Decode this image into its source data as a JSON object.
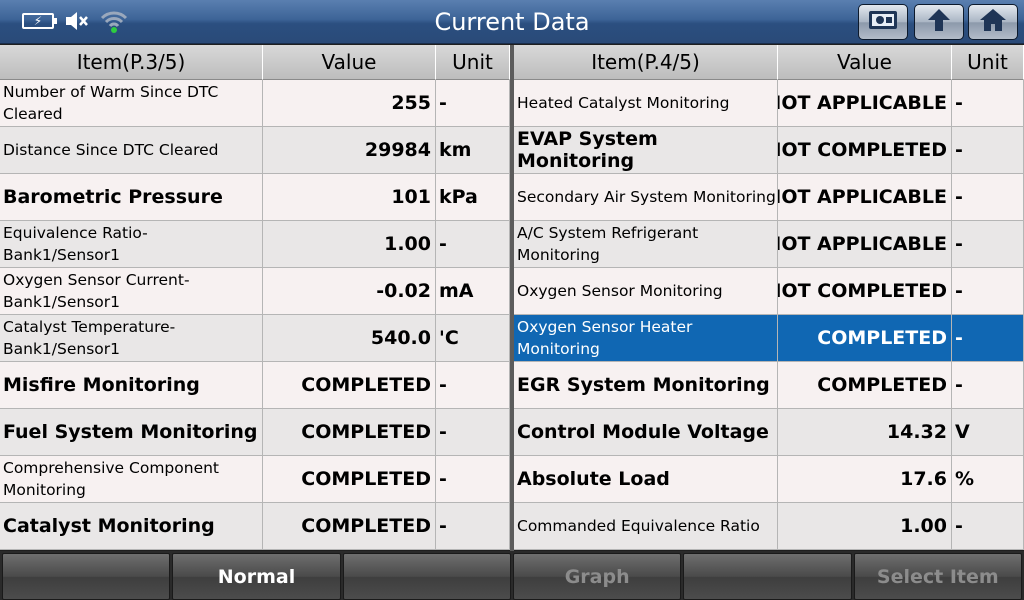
{
  "header": {
    "title": "Current Data",
    "status_icons": [
      "battery-charging-icon",
      "speaker-muted-icon",
      "wifi-icon"
    ],
    "buttons": [
      "screenshot-icon",
      "back-arrow-icon",
      "home-icon"
    ]
  },
  "left_table": {
    "columns": {
      "item": "Item(P.3/5)",
      "value": "Value",
      "unit": "Unit"
    },
    "rows": [
      {
        "item": "Number of Warm Since DTC Cleared",
        "value": "255",
        "unit": "-"
      },
      {
        "item": "Distance Since DTC Cleared",
        "value": "29984",
        "unit": "km"
      },
      {
        "item": "Barometric Pressure",
        "value": "101",
        "unit": "kPa"
      },
      {
        "item": "Equivalence Ratio-Bank1/Sensor1",
        "value": "1.00",
        "unit": "-"
      },
      {
        "item": "Oxygen Sensor Current-Bank1/Sensor1",
        "value": "-0.02",
        "unit": "mA"
      },
      {
        "item": "Catalyst Temperature-Bank1/Sensor1",
        "value": "540.0",
        "unit": "'C"
      },
      {
        "item": "Misfire Monitoring",
        "value": "COMPLETED",
        "unit": "-"
      },
      {
        "item": "Fuel System Monitoring",
        "value": "COMPLETED",
        "unit": "-"
      },
      {
        "item": "Comprehensive Component Monitoring",
        "value": "COMPLETED",
        "unit": "-"
      },
      {
        "item": "Catalyst Monitoring",
        "value": "COMPLETED",
        "unit": "-"
      }
    ]
  },
  "right_table": {
    "columns": {
      "item": "Item(P.4/5)",
      "value": "Value",
      "unit": "Unit"
    },
    "rows": [
      {
        "item": "Heated Catalyst Monitoring",
        "value": "NOT APPLICABLE",
        "unit": "-"
      },
      {
        "item": "EVAP System Monitoring",
        "value": "NOT COMPLETED",
        "unit": "-"
      },
      {
        "item": "Secondary Air System Monitoring",
        "value": "NOT APPLICABLE",
        "unit": "-"
      },
      {
        "item": "A/C System Refrigerant Monitoring",
        "value": "NOT APPLICABLE",
        "unit": "-"
      },
      {
        "item": "Oxygen Sensor Monitoring",
        "value": "NOT COMPLETED",
        "unit": "-"
      },
      {
        "item": "Oxygen Sensor Heater Monitoring",
        "value": "COMPLETED",
        "unit": "-"
      },
      {
        "item": "EGR System Monitoring",
        "value": "COMPLETED",
        "unit": "-"
      },
      {
        "item": "Control Module Voltage",
        "value": "14.32",
        "unit": "V"
      },
      {
        "item": "Absolute Load",
        "value": "17.6",
        "unit": "%"
      },
      {
        "item": "Commanded Equivalence Ratio",
        "value": "1.00",
        "unit": "-"
      }
    ]
  },
  "bottom_bar": {
    "normal_label": "Normal",
    "graph_label": "Graph",
    "select_item_label": "Select Item"
  },
  "colors": {
    "title_bar": "#3d6497",
    "selected_row": "#1067b3",
    "wifi_dot": "#2ecc40"
  }
}
